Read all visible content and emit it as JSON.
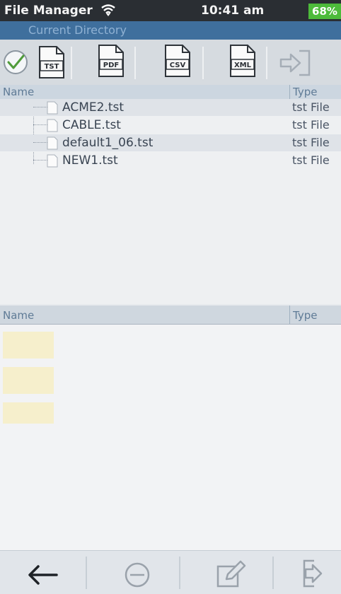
{
  "status_bar": {
    "app_title": "File Manager",
    "time": "10:41 am",
    "battery": "68%"
  },
  "directory": {
    "label": "Current Directory"
  },
  "toolbar": {
    "buttons": [
      {
        "label": "TST",
        "icon": "tst-file-icon"
      },
      {
        "label": "PDF",
        "icon": "pdf-file-icon"
      },
      {
        "label": "CSV",
        "icon": "csv-file-icon"
      },
      {
        "label": "XML",
        "icon": "xml-file-icon"
      }
    ]
  },
  "file_table": {
    "headers": {
      "name": "Name",
      "type": "Type"
    },
    "rows": [
      {
        "name": "ACME2.tst",
        "type": "tst File"
      },
      {
        "name": "CABLE.tst",
        "type": "tst File"
      },
      {
        "name": "default1_06.tst",
        "type": "tst File"
      },
      {
        "name": "NEW1.tst",
        "type": "tst File"
      }
    ]
  },
  "lower_table": {
    "headers": {
      "name": "Name",
      "type": "Type"
    }
  },
  "bottom_bar": {
    "buttons": [
      "back-arrow-icon",
      "remove-icon",
      "edit-icon",
      "exit-icon"
    ]
  },
  "colors": {
    "status_bar": "#2a2e33",
    "directory_bar": "#3f6f9d",
    "battery": "#4dbb3b",
    "check": "#4f9b3a"
  }
}
